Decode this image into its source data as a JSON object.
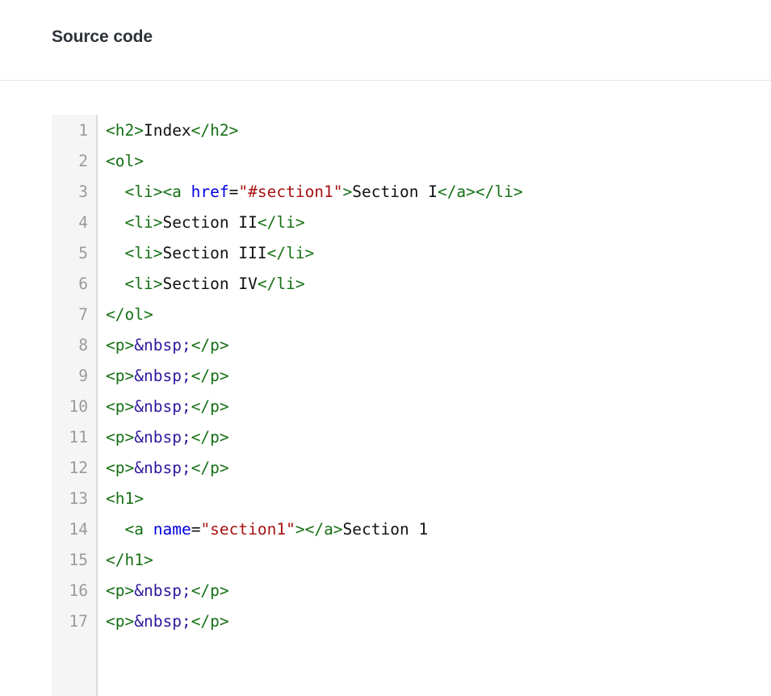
{
  "header": {
    "title": "Source code"
  },
  "code": {
    "language": "html",
    "gutter_start": 1,
    "line_numbers": [
      "1",
      "2",
      "3",
      "4",
      "5",
      "6",
      "7",
      "8",
      "9",
      "10",
      "11",
      "12",
      "13",
      "14",
      "15",
      "16",
      "17"
    ],
    "lines": [
      {
        "number": "1",
        "raw": "<h2>Index</h2>"
      },
      {
        "number": "2",
        "raw": "<ol>"
      },
      {
        "number": "3",
        "raw": "  <li><a href=\"#section1\">Section I</a></li>"
      },
      {
        "number": "4",
        "raw": "  <li>Section II</li>"
      },
      {
        "number": "5",
        "raw": "  <li>Section III</li>"
      },
      {
        "number": "6",
        "raw": "  <li>Section IV</li>"
      },
      {
        "number": "7",
        "raw": "</ol>"
      },
      {
        "number": "8",
        "raw": "<p>&nbsp;</p>"
      },
      {
        "number": "9",
        "raw": "<p>&nbsp;</p>"
      },
      {
        "number": "10",
        "raw": "<p>&nbsp;</p>"
      },
      {
        "number": "11",
        "raw": "<p>&nbsp;</p>"
      },
      {
        "number": "12",
        "raw": "<p>&nbsp;</p>"
      },
      {
        "number": "13",
        "raw": "<h1>"
      },
      {
        "number": "14",
        "raw": "  <a name=\"section1\"></a>Section 1"
      },
      {
        "number": "15",
        "raw": "</h1>"
      },
      {
        "number": "16",
        "raw": "<p>&nbsp;</p>"
      },
      {
        "number": "17",
        "raw": "<p>&nbsp;</p>"
      }
    ],
    "tokens": [
      [
        {
          "t": "tag",
          "v": "<h2>"
        },
        {
          "t": "text",
          "v": "Index"
        },
        {
          "t": "tag",
          "v": "</h2>"
        }
      ],
      [
        {
          "t": "tag",
          "v": "<ol>"
        }
      ],
      [
        {
          "t": "text",
          "v": "  "
        },
        {
          "t": "tag",
          "v": "<li><a "
        },
        {
          "t": "attr",
          "v": "href"
        },
        {
          "t": "punct",
          "v": "="
        },
        {
          "t": "val",
          "v": "\"#section1\""
        },
        {
          "t": "tag",
          "v": ">"
        },
        {
          "t": "text",
          "v": "Section I"
        },
        {
          "t": "tag",
          "v": "</a></li>"
        }
      ],
      [
        {
          "t": "text",
          "v": "  "
        },
        {
          "t": "tag",
          "v": "<li>"
        },
        {
          "t": "text",
          "v": "Section II"
        },
        {
          "t": "tag",
          "v": "</li>"
        }
      ],
      [
        {
          "t": "text",
          "v": "  "
        },
        {
          "t": "tag",
          "v": "<li>"
        },
        {
          "t": "text",
          "v": "Section III"
        },
        {
          "t": "tag",
          "v": "</li>"
        }
      ],
      [
        {
          "t": "text",
          "v": "  "
        },
        {
          "t": "tag",
          "v": "<li>"
        },
        {
          "t": "text",
          "v": "Section IV"
        },
        {
          "t": "tag",
          "v": "</li>"
        }
      ],
      [
        {
          "t": "tag",
          "v": "</ol>"
        }
      ],
      [
        {
          "t": "tag",
          "v": "<p>"
        },
        {
          "t": "entity",
          "v": "&nbsp;"
        },
        {
          "t": "tag",
          "v": "</p>"
        }
      ],
      [
        {
          "t": "tag",
          "v": "<p>"
        },
        {
          "t": "entity",
          "v": "&nbsp;"
        },
        {
          "t": "tag",
          "v": "</p>"
        }
      ],
      [
        {
          "t": "tag",
          "v": "<p>"
        },
        {
          "t": "entity",
          "v": "&nbsp;"
        },
        {
          "t": "tag",
          "v": "</p>"
        }
      ],
      [
        {
          "t": "tag",
          "v": "<p>"
        },
        {
          "t": "entity",
          "v": "&nbsp;"
        },
        {
          "t": "tag",
          "v": "</p>"
        }
      ],
      [
        {
          "t": "tag",
          "v": "<p>"
        },
        {
          "t": "entity",
          "v": "&nbsp;"
        },
        {
          "t": "tag",
          "v": "</p>"
        }
      ],
      [
        {
          "t": "tag",
          "v": "<h1>"
        }
      ],
      [
        {
          "t": "text",
          "v": "  "
        },
        {
          "t": "tag",
          "v": "<a "
        },
        {
          "t": "attr",
          "v": "name"
        },
        {
          "t": "punct",
          "v": "="
        },
        {
          "t": "val",
          "v": "\"section1\""
        },
        {
          "t": "tag",
          "v": "></a>"
        },
        {
          "t": "text",
          "v": "Section 1"
        }
      ],
      [
        {
          "t": "tag",
          "v": "</h1>"
        }
      ],
      [
        {
          "t": "tag",
          "v": "<p>"
        },
        {
          "t": "entity",
          "v": "&nbsp;"
        },
        {
          "t": "tag",
          "v": "</p>"
        }
      ],
      [
        {
          "t": "tag",
          "v": "<p>"
        },
        {
          "t": "entity",
          "v": "&nbsp;"
        },
        {
          "t": "tag",
          "v": "</p>"
        }
      ]
    ]
  },
  "colors": {
    "background": "#ffffff",
    "title": "#2c3239",
    "header_rule": "#e6e6e6",
    "gutter_bg": "#f5f5f5",
    "gutter_border": "#dcdcdc",
    "line_number": "#9a9a9a",
    "token_tag": "#157015",
    "token_attr": "#0000e0",
    "token_value": "#a81212",
    "token_text": "#111111",
    "token_entity": "#2b1a9e"
  }
}
